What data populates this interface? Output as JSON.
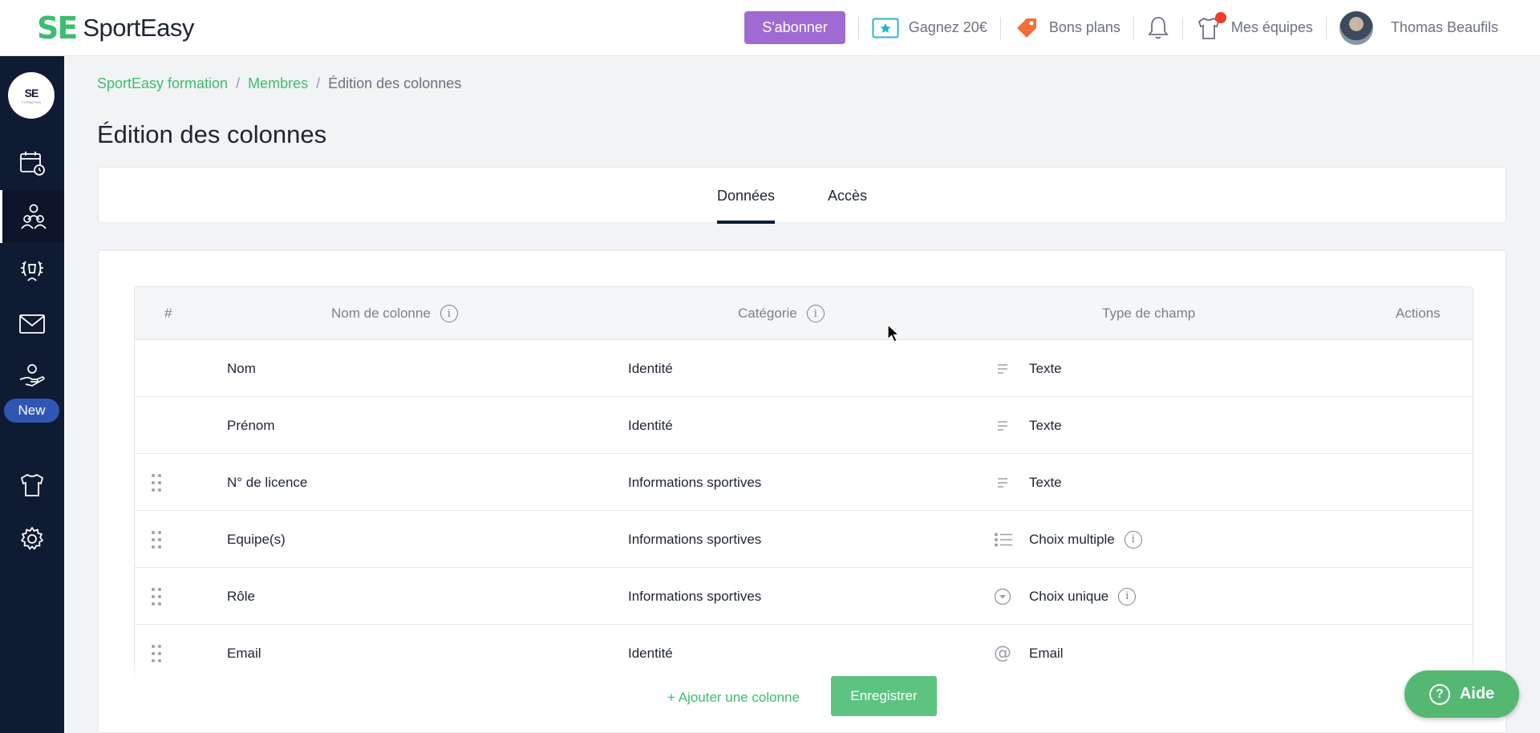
{
  "brand": {
    "mark": "SE",
    "name": "SportEasy"
  },
  "topbar": {
    "subscribe_label": "S'abonner",
    "earn_label": "Gagnez 20€",
    "deals_label": "Bons plans",
    "teams_label": "Mes équipes",
    "user_name": "Thomas Beaufils"
  },
  "sidebar": {
    "team_logo_text": "SE",
    "team_logo_sub": "FORMATION",
    "new_badge": "New",
    "icons": [
      "calendar-icon",
      "members-icon",
      "trophy-icon",
      "mail-icon",
      "hand-heart-icon",
      "jersey-icon",
      "gear-icon"
    ]
  },
  "breadcrumb": {
    "item1": "SportEasy formation",
    "item2": "Membres",
    "current": "Édition des colonnes",
    "separator": "/"
  },
  "page": {
    "title": "Édition des colonnes"
  },
  "tabs": {
    "data_label": "Données",
    "access_label": "Accès"
  },
  "table": {
    "headers": {
      "num": "#",
      "name": "Nom de colonne",
      "category": "Catégorie",
      "type": "Type de champ",
      "actions": "Actions"
    },
    "rows": [
      {
        "name": "Nom",
        "category": "Identité",
        "type": "Texte",
        "type_icon": "text-lines-icon"
      },
      {
        "name": "Prénom",
        "category": "Identité",
        "type": "Texte",
        "type_icon": "text-lines-icon"
      },
      {
        "name": "N° de licence",
        "category": "Informations sportives",
        "type": "Texte",
        "type_icon": "text-lines-icon"
      },
      {
        "name": "Equipe(s)",
        "category": "Informations sportives",
        "type": "Choix multiple",
        "type_icon": "list-icon"
      },
      {
        "name": "Rôle",
        "category": "Informations sportives",
        "type": "Choix unique",
        "type_icon": "dropdown-circle-icon"
      },
      {
        "name": "Email",
        "category": "Identité",
        "type": "Email",
        "type_icon": "at-icon"
      }
    ]
  },
  "footer": {
    "add_column_label": "+ Ajouter une colonne",
    "save_label": "Enregistrer"
  },
  "help": {
    "label": "Aide",
    "glyph": "?"
  },
  "colors": {
    "brand_green": "#3dbd6d",
    "sidebar_bg": "#0f1a33",
    "subscribe_purple": "#9f6bd2"
  }
}
